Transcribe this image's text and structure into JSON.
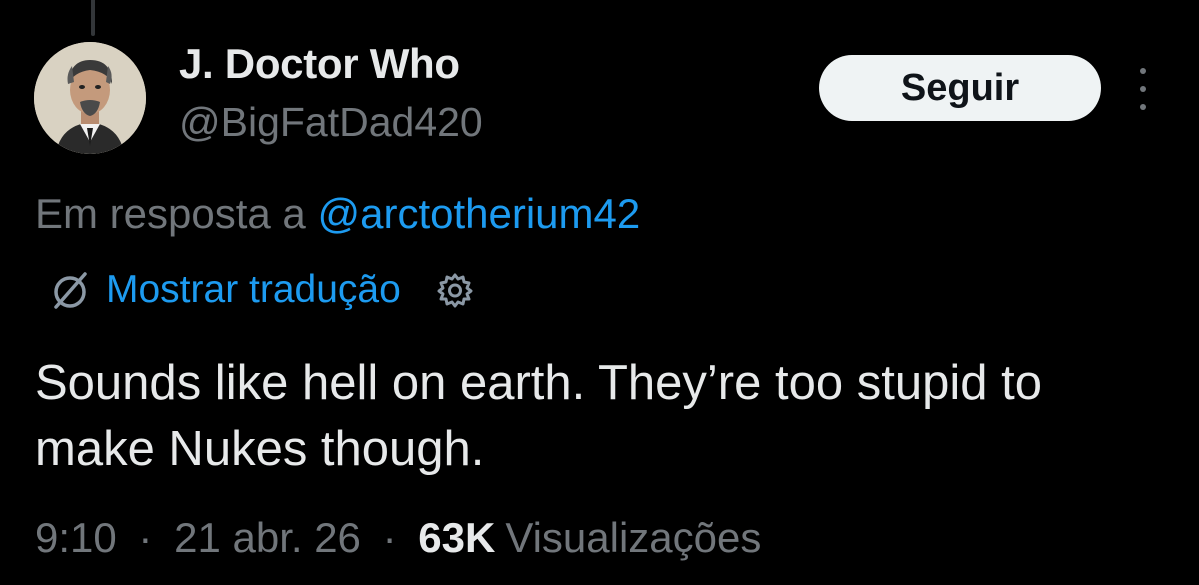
{
  "author": {
    "display_name": "J. Doctor Who",
    "handle": "@BigFatDad420",
    "avatar_icon": "profile-avatar"
  },
  "actions": {
    "follow_label": "Seguir",
    "more_icon": "more-vertical-icon"
  },
  "reply": {
    "prefix": "Em resposta a",
    "mention": "@arctotherium42"
  },
  "translation": {
    "icon": "translate-icon",
    "label": "Mostrar tradução",
    "settings_icon": "gear-icon"
  },
  "tweet": {
    "text": "Sounds like hell on earth. They’re too stupid to make Nukes though."
  },
  "meta": {
    "time": "9:10",
    "separator": "·",
    "date": "21 abr. 26",
    "views_count": "63K",
    "views_label": "Visualizações"
  },
  "colors": {
    "background": "#000000",
    "primary_text": "#e7e9ea",
    "secondary_text": "#71767b",
    "link": "#1d9bf0",
    "button_bg": "#eff3f4",
    "button_text": "#0f1419"
  }
}
